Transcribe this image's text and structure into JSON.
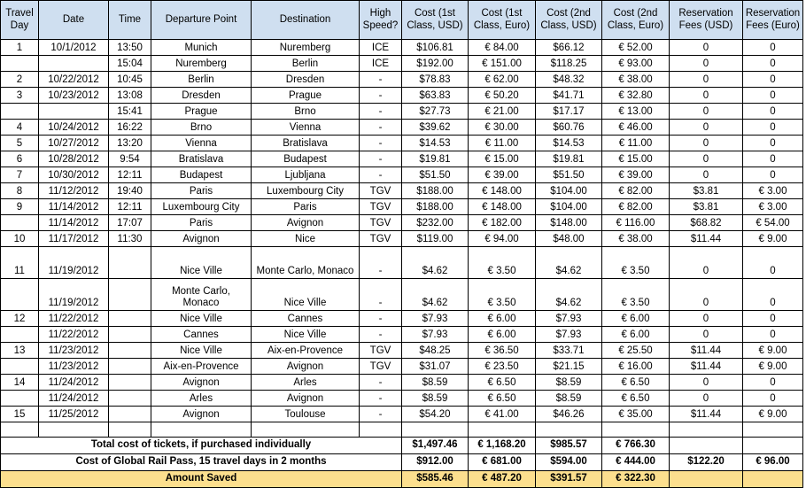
{
  "colors": {
    "header_bg": "#cfdff0",
    "highlight_bg": "#fcdf8e",
    "grid_line": "#000000",
    "text": "#000000"
  },
  "table": {
    "headers": [
      "Travel Day",
      "Date",
      "Time",
      "Departure Point",
      "Destination",
      "High Speed?",
      "Cost (1st Class, USD)",
      "Cost (1st Class, Euro)",
      "Cost (2nd Class, USD)",
      "Cost (2nd Class, Euro)",
      "Reservation Fees (USD)",
      "Reservation Fees (Euro)"
    ],
    "rows": [
      {
        "tall": false,
        "cells": [
          "1",
          "10/1/2012",
          "13:50",
          "Munich",
          "Nuremberg",
          "ICE",
          "$106.81",
          "€ 84.00",
          "$66.12",
          "€ 52.00",
          "0",
          "0"
        ]
      },
      {
        "tall": false,
        "cells": [
          "",
          "",
          "15:04",
          "Nuremberg",
          "Berlin",
          "ICE",
          "$192.00",
          "€ 151.00",
          "$118.25",
          "€ 93.00",
          "0",
          "0"
        ]
      },
      {
        "tall": false,
        "cells": [
          "2",
          "10/22/2012",
          "10:45",
          "Berlin",
          "Dresden",
          "-",
          "$78.83",
          "€ 62.00",
          "$48.32",
          "€ 38.00",
          "0",
          "0"
        ]
      },
      {
        "tall": false,
        "cells": [
          "3",
          "10/23/2012",
          "13:08",
          "Dresden",
          "Prague",
          "-",
          "$63.83",
          "€ 50.20",
          "$41.71",
          "€ 32.80",
          "0",
          "0"
        ]
      },
      {
        "tall": false,
        "cells": [
          "",
          "",
          "15:41",
          "Prague",
          "Brno",
          "-",
          "$27.73",
          "€ 21.00",
          "$17.17",
          "€ 13.00",
          "0",
          "0"
        ]
      },
      {
        "tall": false,
        "cells": [
          "4",
          "10/24/2012",
          "16:22",
          "Brno",
          "Vienna",
          "-",
          "$39.62",
          "€ 30.00",
          "$60.76",
          "€ 46.00",
          "0",
          "0"
        ]
      },
      {
        "tall": false,
        "cells": [
          "5",
          "10/27/2012",
          "13:20",
          "Vienna",
          "Bratislava",
          "-",
          "$14.53",
          "€ 11.00",
          "$14.53",
          "€ 11.00",
          "0",
          "0"
        ]
      },
      {
        "tall": false,
        "cells": [
          "6",
          "10/28/2012",
          "9:54",
          "Bratislava",
          "Budapest",
          "-",
          "$19.81",
          "€ 15.00",
          "$19.81",
          "€ 15.00",
          "0",
          "0"
        ]
      },
      {
        "tall": false,
        "cells": [
          "7",
          "10/30/2012",
          "12:11",
          "Budapest",
          "Ljubljana",
          "-",
          "$51.50",
          "€ 39.00",
          "$51.50",
          "€ 39.00",
          "0",
          "0"
        ]
      },
      {
        "tall": false,
        "cells": [
          "8",
          "11/12/2012",
          "19:40",
          "Paris",
          "Luxembourg City",
          "TGV",
          "$188.00",
          "€ 148.00",
          "$104.00",
          "€ 82.00",
          "$3.81",
          "€ 3.00"
        ]
      },
      {
        "tall": false,
        "cells": [
          "9",
          "11/14/2012",
          "12:11",
          "Luxembourg City",
          "Paris",
          "TGV",
          "$188.00",
          "€ 148.00",
          "$104.00",
          "€ 82.00",
          "$3.81",
          "€ 3.00"
        ]
      },
      {
        "tall": false,
        "cells": [
          "",
          "11/14/2012",
          "17:07",
          "Paris",
          "Avignon",
          "TGV",
          "$232.00",
          "€ 182.00",
          "$148.00",
          "€ 116.00",
          "$68.82",
          "€ 54.00"
        ]
      },
      {
        "tall": false,
        "cells": [
          "10",
          "11/17/2012",
          "11:30",
          "Avignon",
          "Nice",
          "TGV",
          "$119.00",
          "€ 94.00",
          "$48.00",
          "€ 38.00",
          "$11.44",
          "€ 9.00"
        ]
      },
      {
        "tall": true,
        "cells": [
          "11",
          "11/19/2012",
          "",
          "Nice Ville",
          "Monte Carlo, Monaco",
          "-",
          "$4.62",
          "€ 3.50",
          "$4.62",
          "€ 3.50",
          "0",
          "0"
        ]
      },
      {
        "tall": true,
        "cells": [
          "",
          "11/19/2012",
          "",
          "Monte Carlo, Monaco",
          "Nice Ville",
          "-",
          "$4.62",
          "€ 3.50",
          "$4.62",
          "€ 3.50",
          "0",
          "0"
        ]
      },
      {
        "tall": false,
        "cells": [
          "12",
          "11/22/2012",
          "",
          "Nice Ville",
          "Cannes",
          "-",
          "$7.93",
          "€ 6.00",
          "$7.93",
          "€ 6.00",
          "0",
          "0"
        ]
      },
      {
        "tall": false,
        "cells": [
          "",
          "11/22/2012",
          "",
          "Cannes",
          "Nice Ville",
          "-",
          "$7.93",
          "€ 6.00",
          "$7.93",
          "€ 6.00",
          "0",
          "0"
        ]
      },
      {
        "tall": false,
        "cells": [
          "13",
          "11/23/2012",
          "",
          "Nice Ville",
          "Aix-en-Provence",
          "TGV",
          "$48.25",
          "€ 36.50",
          "$33.71",
          "€ 25.50",
          "$11.44",
          "€ 9.00"
        ]
      },
      {
        "tall": false,
        "cells": [
          "",
          "11/23/2012",
          "",
          "Aix-en-Provence",
          "Avignon",
          "TGV",
          "$31.07",
          "€ 23.50",
          "$21.15",
          "€ 16.00",
          "$11.44",
          "€ 9.00"
        ]
      },
      {
        "tall": false,
        "cells": [
          "14",
          "11/24/2012",
          "",
          "Avignon",
          "Arles",
          "-",
          "$8.59",
          "€ 6.50",
          "$8.59",
          "€ 6.50",
          "0",
          "0"
        ]
      },
      {
        "tall": false,
        "cells": [
          "",
          "11/24/2012",
          "",
          "Arles",
          "Avignon",
          "-",
          "$8.59",
          "€ 6.50",
          "$8.59",
          "€ 6.50",
          "0",
          "0"
        ]
      },
      {
        "tall": false,
        "cells": [
          "15",
          "11/25/2012",
          "",
          "Avignon",
          "Toulouse",
          "-",
          "$54.20",
          "€ 41.00",
          "$46.26",
          "€ 35.00",
          "$11.44",
          "€ 9.00"
        ]
      },
      {
        "tall": false,
        "blank": true,
        "cells": [
          "",
          "",
          "",
          "",
          "",
          "",
          "",
          "",
          "",
          "",
          "",
          ""
        ]
      }
    ],
    "summary_rows": [
      {
        "label": "Total cost of tickets, if purchased individually",
        "highlight": false,
        "values": [
          "$1,497.46",
          "€ 1,168.20",
          "$985.57",
          "€ 766.30",
          "",
          ""
        ]
      },
      {
        "label": "Cost of Global Rail Pass, 15 travel days in 2 months",
        "highlight": false,
        "values": [
          "$912.00",
          "€ 681.00",
          "$594.00",
          "€ 444.00",
          "$122.20",
          "€ 96.00"
        ]
      },
      {
        "label": "Amount Saved",
        "highlight": true,
        "values": [
          "$585.46",
          "€ 487.20",
          "$391.57",
          "€ 322.30",
          "",
          ""
        ]
      }
    ]
  }
}
